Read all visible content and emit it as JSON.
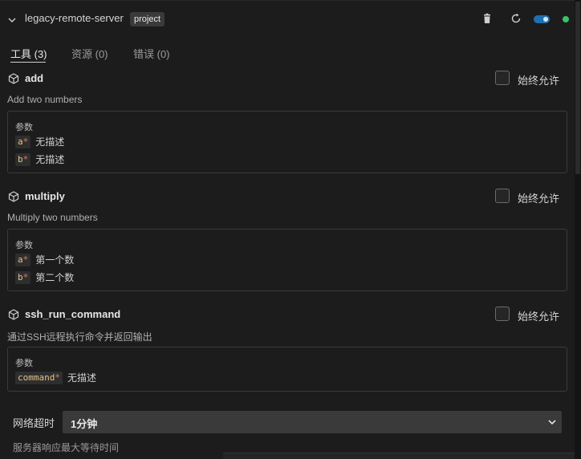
{
  "server": {
    "name": "legacy-remote-server",
    "badge": "project",
    "enabled": true
  },
  "tabs": [
    {
      "label": "工具 (3)",
      "active": true
    },
    {
      "label": "资源 (0)",
      "active": false
    },
    {
      "label": "错误 (0)",
      "active": false
    }
  ],
  "allow_label": "始终允许",
  "params_label": "参数",
  "tools": [
    {
      "name": "add",
      "description": "Add two numbers",
      "params": [
        {
          "name": "a",
          "required": "*",
          "desc": "无描述"
        },
        {
          "name": "b",
          "required": "*",
          "desc": "无描述"
        }
      ]
    },
    {
      "name": "multiply",
      "description": "Multiply two numbers",
      "params": [
        {
          "name": "a",
          "required": "*",
          "desc": "第一个数"
        },
        {
          "name": "b",
          "required": "*",
          "desc": "第二个数"
        }
      ]
    },
    {
      "name": "ssh_run_command",
      "description": "通过SSH远程执行命令并返回输出",
      "params": [
        {
          "name": "command",
          "required": "*",
          "desc": "无描述"
        }
      ]
    }
  ],
  "timeout": {
    "label": "网络超时",
    "value": "1分钟",
    "hint": "服务器响应最大等待时间"
  },
  "colors": {
    "toggle_on": "#1f6fb2",
    "status_connected": "#39c26a",
    "param_name": "#e2c28a",
    "required_star": "#e07a6a"
  },
  "icons": {
    "collapse": "chevron-down-icon",
    "delete": "trash-icon",
    "refresh": "refresh-icon",
    "tool": "cube-icon"
  }
}
